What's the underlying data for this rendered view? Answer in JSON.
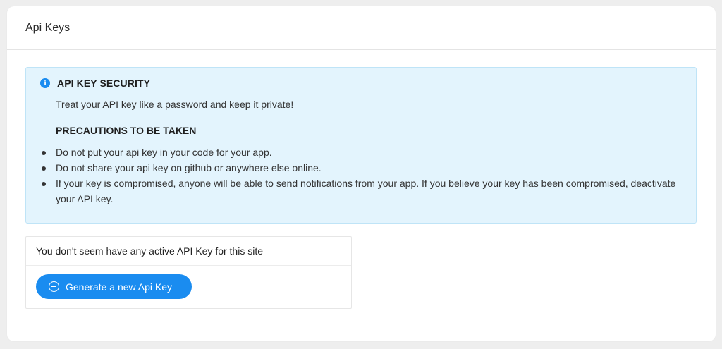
{
  "header": {
    "title": "Api Keys"
  },
  "alert": {
    "icon": "info-icon",
    "title": "API KEY SECURITY",
    "description": "Treat your API key like a password and keep it private!",
    "precautions_title": "PRECAUTIONS TO BE TAKEN",
    "precautions": [
      "Do not put your api key in your code for your app.",
      "Do not share your api key on github or anywhere else online.",
      "If your key is compromised, anyone will be able to send notifications from your app. If you believe your key has been compromised, deactivate your API key."
    ]
  },
  "keys": {
    "empty_message": "You don't seem have any active API Key for this site",
    "generate_label": "Generate a new Api Key",
    "generate_icon": "plus-circle-icon"
  },
  "colors": {
    "accent": "#1a8cf0",
    "alert_bg": "#e3f4fd",
    "alert_border": "#bfe4f7"
  }
}
